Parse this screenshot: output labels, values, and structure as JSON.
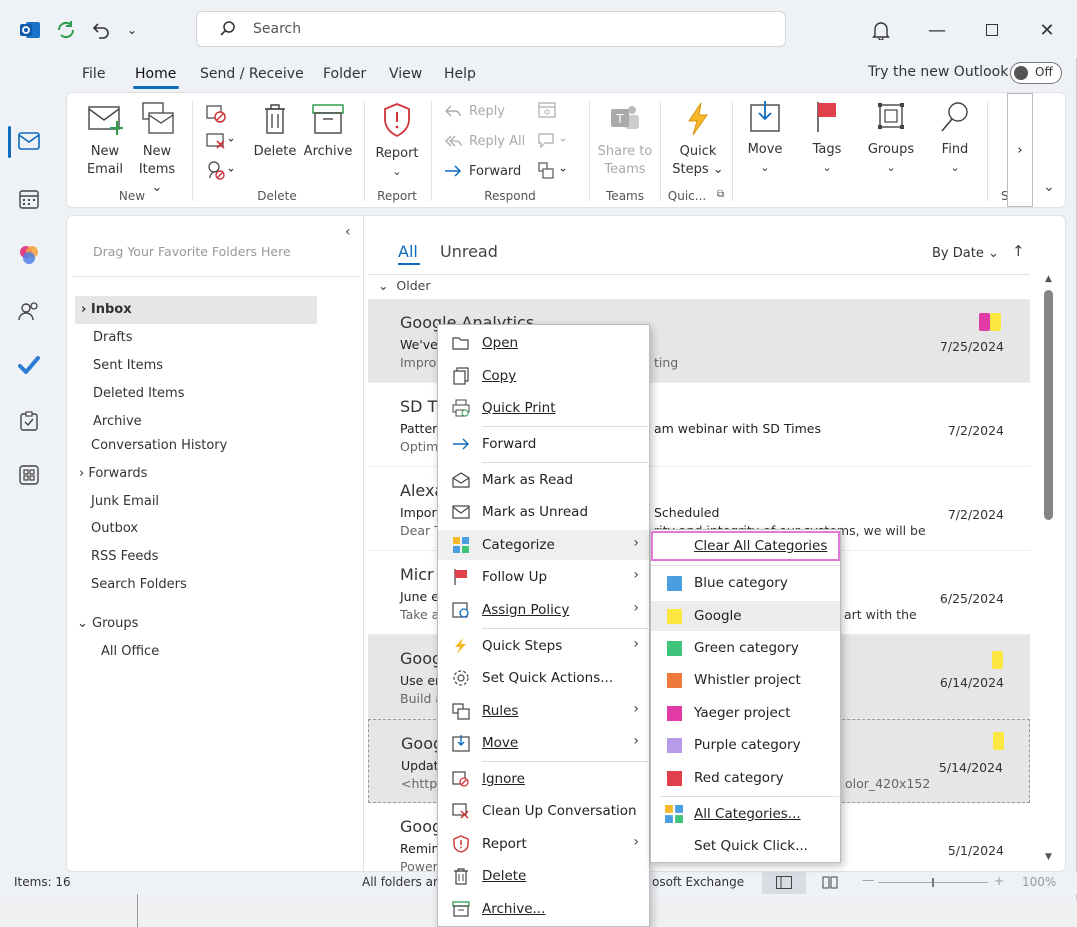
{
  "search": {
    "placeholder": "Search"
  },
  "menu_tabs": [
    "File",
    "Home",
    "Send / Receive",
    "Folder",
    "View",
    "Help"
  ],
  "try_new_outlook": {
    "label": "Try the new Outlook",
    "state": "Off"
  },
  "ribbon": {
    "new_email": [
      "New",
      "Email"
    ],
    "new_items": [
      "New",
      "Items"
    ],
    "group_new": "New",
    "delete": "Delete",
    "archive": "Archive",
    "group_delete": "Delete",
    "report": "Report",
    "group_report": "Report",
    "reply": "Reply",
    "reply_all": "Reply All",
    "forward": "Forward",
    "group_respond": "Respond",
    "share_to_teams": [
      "Share to",
      "Teams"
    ],
    "group_teams": "Teams",
    "quick_steps": [
      "Quick",
      "Steps"
    ],
    "group_quick": "Quic...",
    "move": "Move",
    "tags": "Tags",
    "groups": "Groups",
    "find": "Find",
    "overflow_label": "S"
  },
  "folders": {
    "favorites_hint": "Drag Your Favorite Folders Here",
    "items": [
      "Inbox",
      "Drafts",
      "Sent Items",
      "Deleted Items",
      "Archive",
      "Conversation History",
      "Forwards",
      "Junk Email",
      "Outbox",
      "RSS Feeds",
      "Search Folders"
    ],
    "groups_header": "Groups",
    "groups_items": [
      "All Office"
    ]
  },
  "list": {
    "filter_all": "All",
    "filter_unread": "Unread",
    "sort": "By Date",
    "section": "Older",
    "messages": [
      {
        "sender": "Google Analytics",
        "subject": "We've",
        "preview": "Improv",
        "preview_tail": "ting",
        "date": "7/25/2024"
      },
      {
        "sender": "SD T",
        "subject": "Patter",
        "subject_tail": "am webinar with SD Times",
        "preview": "Optim",
        "date": "7/2/2024"
      },
      {
        "sender": "Alexa",
        "subject": "Impor",
        "subject_tail": "Scheduled",
        "preview": "Dear T",
        "preview_tail": "rity and integrity of our systems, we will be",
        "date": "7/2/2024"
      },
      {
        "sender": "Micr",
        "subject": "June e",
        "preview": "Take a",
        "preview_tail": "art with the",
        "date": "6/25/2024"
      },
      {
        "sender": "Goog",
        "subject": "Use er",
        "preview": "Build a",
        "date": "6/14/2024"
      },
      {
        "sender": "Goog",
        "subject": "Updat",
        "preview": "<http",
        "preview_tail": "olor_420x152",
        "date": "5/14/2024"
      },
      {
        "sender": "Goog",
        "subject": "Remin",
        "preview": "Power",
        "date": "5/1/2024"
      }
    ]
  },
  "status": {
    "items": "Items: 16",
    "folders_state": "All folders ar",
    "exchange": "osoft Exchange",
    "zoom": "100%"
  },
  "context_menu": [
    {
      "label": "Open",
      "icon": "folder-open-icon"
    },
    {
      "label": "Copy",
      "icon": "copy-icon"
    },
    {
      "label": "Quick Print",
      "icon": "print-icon"
    },
    {
      "label": "Forward",
      "icon": "forward-arrow-icon"
    },
    {
      "label": "Mark as Read",
      "icon": "envelope-open-icon"
    },
    {
      "label": "Mark as Unread",
      "icon": "envelope-icon"
    },
    {
      "label": "Categorize",
      "icon": "categorize-icon"
    },
    {
      "label": "Follow Up",
      "icon": "flag-icon"
    },
    {
      "label": "Assign Policy",
      "icon": "policy-icon"
    },
    {
      "label": "Quick Steps",
      "icon": "lightning-icon"
    },
    {
      "label": "Set Quick Actions...",
      "icon": "gear-icon"
    },
    {
      "label": "Rules",
      "icon": "rules-icon"
    },
    {
      "label": "Move",
      "icon": "move-icon"
    },
    {
      "label": "Ignore",
      "icon": "ignore-icon"
    },
    {
      "label": "Clean Up Conversation",
      "icon": "cleanup-icon"
    },
    {
      "label": "Report",
      "icon": "shield-icon"
    },
    {
      "label": "Delete",
      "icon": "trash-icon"
    },
    {
      "label": "Archive...",
      "icon": "archive-icon"
    }
  ],
  "categorize_menu": {
    "clear_all": "Clear All Categories",
    "categories": [
      {
        "label": "Blue category",
        "color": "#4a9fe0"
      },
      {
        "label": "Google",
        "color": "#fbe73f"
      },
      {
        "label": "Green category",
        "color": "#3fc47c"
      },
      {
        "label": "Whistler project",
        "color": "#f07a3c"
      },
      {
        "label": "Yaeger project",
        "color": "#e23ba7"
      },
      {
        "label": "Purple category",
        "color": "#b79bea"
      },
      {
        "label": "Red category",
        "color": "#e0404a"
      }
    ],
    "all_categories": "All Categories...",
    "set_quick_click": "Set Quick Click..."
  }
}
